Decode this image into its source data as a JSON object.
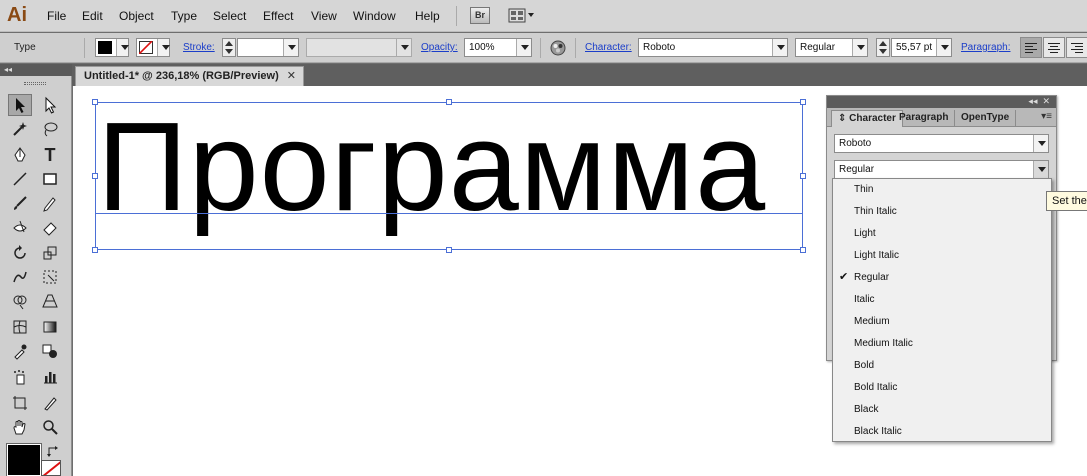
{
  "app": {
    "logo": "Ai"
  },
  "menu": [
    "File",
    "Edit",
    "Object",
    "Type",
    "Select",
    "Effect",
    "View",
    "Window",
    "Help"
  ],
  "bridge_button": "Br",
  "control_bar": {
    "tool_label": "Type",
    "stroke_label": "Stroke:",
    "opacity_label": "Opacity:",
    "opacity_value": "100%",
    "character_label": "Character:",
    "font_family": "Roboto",
    "font_style": "Regular",
    "font_size": "55,57 pt",
    "paragraph_label": "Paragraph:"
  },
  "document_tab": {
    "title": "Untitled-1* @ 236,18% (RGB/Preview)",
    "close": "✕"
  },
  "artboard": {
    "text": "Программа"
  },
  "character_panel": {
    "tabs": [
      "Character",
      "Paragraph",
      "OpenType"
    ],
    "active_tab": "Character",
    "font_family": "Roboto",
    "font_style": "Regular"
  },
  "weight_list": {
    "items": [
      "Thin",
      "Thin Italic",
      "Light",
      "Light Italic",
      "Regular",
      "Italic",
      "Medium",
      "Medium Italic",
      "Bold",
      "Bold Italic",
      "Black",
      "Black Italic"
    ],
    "selected": "Regular"
  },
  "tooltip": "Set the",
  "colors": {
    "selection": "#4b6fd6",
    "link": "#1b3ec9",
    "logo": "#8a4a14"
  }
}
